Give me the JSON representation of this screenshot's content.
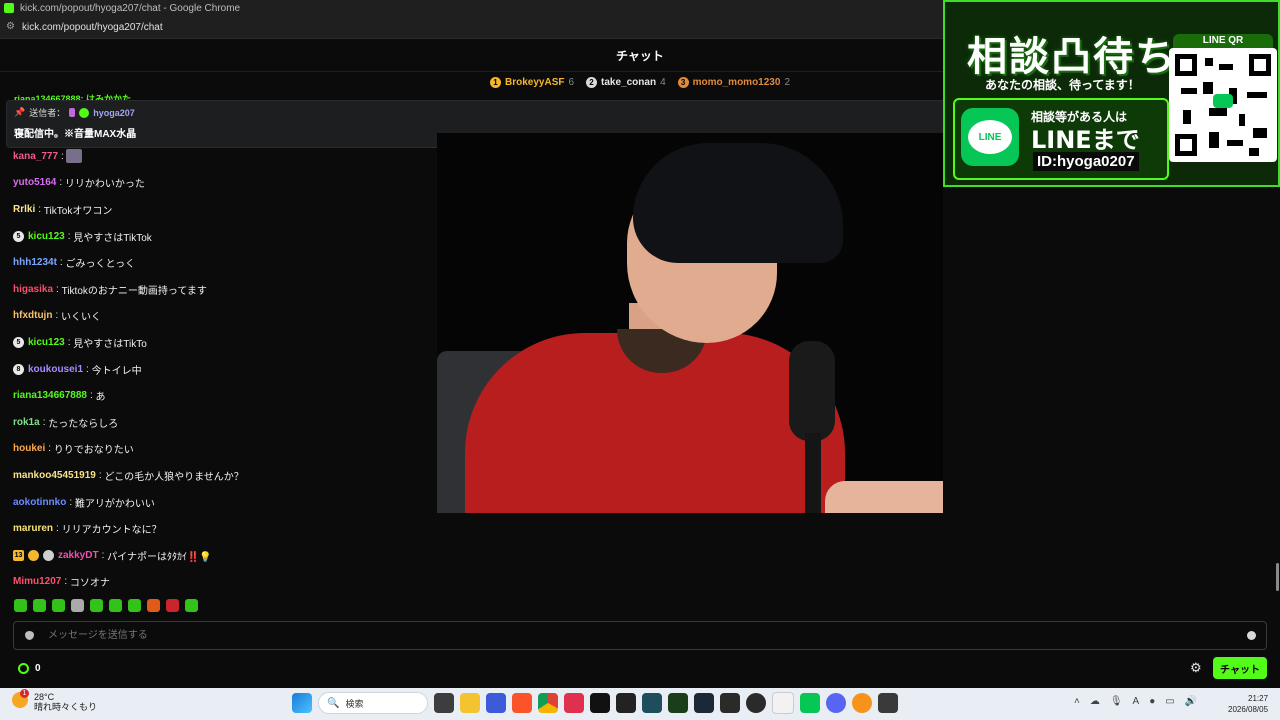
{
  "browser": {
    "title": "kick.com/popout/hyoga207/chat - Google Chrome",
    "url": "kick.com/popout/hyoga207/chat"
  },
  "chat": {
    "header": "チャット",
    "leaderboard": [
      {
        "name": "BrokeyyASF",
        "count": "6",
        "color": "#f5b82a",
        "badge": "1"
      },
      {
        "name": "take_conan",
        "count": "4",
        "color": "#d9d9d9",
        "badge": "2"
      },
      {
        "name": "momo_momo1230",
        "count": "2",
        "color": "#e08a3c",
        "badge": "3"
      }
    ],
    "partial_top": "riana134667888: はみかかた",
    "pinned": {
      "label": "送信者：",
      "user": "hyoga207",
      "message": "寝配信中。※音量MAX水晶"
    },
    "messages": [
      {
        "user": "kana_777",
        "color": "#f05a8c",
        "text": "",
        "badge": "",
        "emote": true
      },
      {
        "user": "yuto5164",
        "color": "#d86cf0",
        "text": "リリかわいかった",
        "badge": ""
      },
      {
        "user": "Rrlki",
        "color": "#ffe28a",
        "text": "TikTokオワコン",
        "badge": ""
      },
      {
        "user": "kicu123",
        "color": "#53fc18",
        "text": "見やすさはTikTok",
        "badge": "5"
      },
      {
        "user": "hhh1234t",
        "color": "#7aa8ff",
        "text": "ごみっくとっく",
        "badge": ""
      },
      {
        "user": "higasika",
        "color": "#ff4b6b",
        "text": "Tiktokのおナニー動画持ってます",
        "badge": ""
      },
      {
        "user": "hfxdtujn",
        "color": "#f6c26b",
        "text": "いくいく",
        "badge": ""
      },
      {
        "user": "kicu123",
        "color": "#53fc18",
        "text": "見やすさはTikTo",
        "badge": "5"
      },
      {
        "user": "koukousei1",
        "color": "#a98cff",
        "text": "今トイレ中",
        "badge": "8"
      },
      {
        "user": "riana134667888",
        "color": "#53fc18",
        "text": "あ",
        "badge": ""
      },
      {
        "user": "rok1a",
        "color": "#7ee08c",
        "text": "たったならしろ",
        "badge": ""
      },
      {
        "user": "houkei",
        "color": "#ffa84a",
        "text": "りりでおなりたい",
        "badge": ""
      },
      {
        "user": "mankoo45451919",
        "color": "#f5e28a",
        "text": "どこの毛か人狼やりませんか？",
        "badge": ""
      },
      {
        "user": "aokotinnko",
        "color": "#6c8cff",
        "text": "難アリがかわいい",
        "badge": ""
      },
      {
        "user": "maruren",
        "color": "#f7e27a",
        "text": "リリアカウントなに？",
        "badge": ""
      },
      {
        "user": "zakkyDT",
        "color": "#f050b0",
        "text": "パイナポーはﾀﾀｶｲ‼️💡",
        "badge": "13"
      },
      {
        "user": "Mimu1207",
        "color": "#ff4e6e",
        "text": "コソオナ",
        "badge": ""
      }
    ],
    "input_placeholder": "メッセージを送信する",
    "points": "0",
    "send_label": "チャット"
  },
  "ad": {
    "headline": "相談凸待ち",
    "subline": "あなたの相談、待ってます！",
    "line_text1": "相談等がある人は",
    "line_text2": "LINEまで",
    "line_id": "ID:hyoga0207",
    "qr_label": "LINE QR",
    "logo_text": "LINE"
  },
  "taskbar": {
    "weather_temp": "28°C",
    "weather_desc": "晴れ時々くもり",
    "weather_badge": "1",
    "search_placeholder": "検索",
    "time": "21:27",
    "date": "2026/08/05"
  }
}
